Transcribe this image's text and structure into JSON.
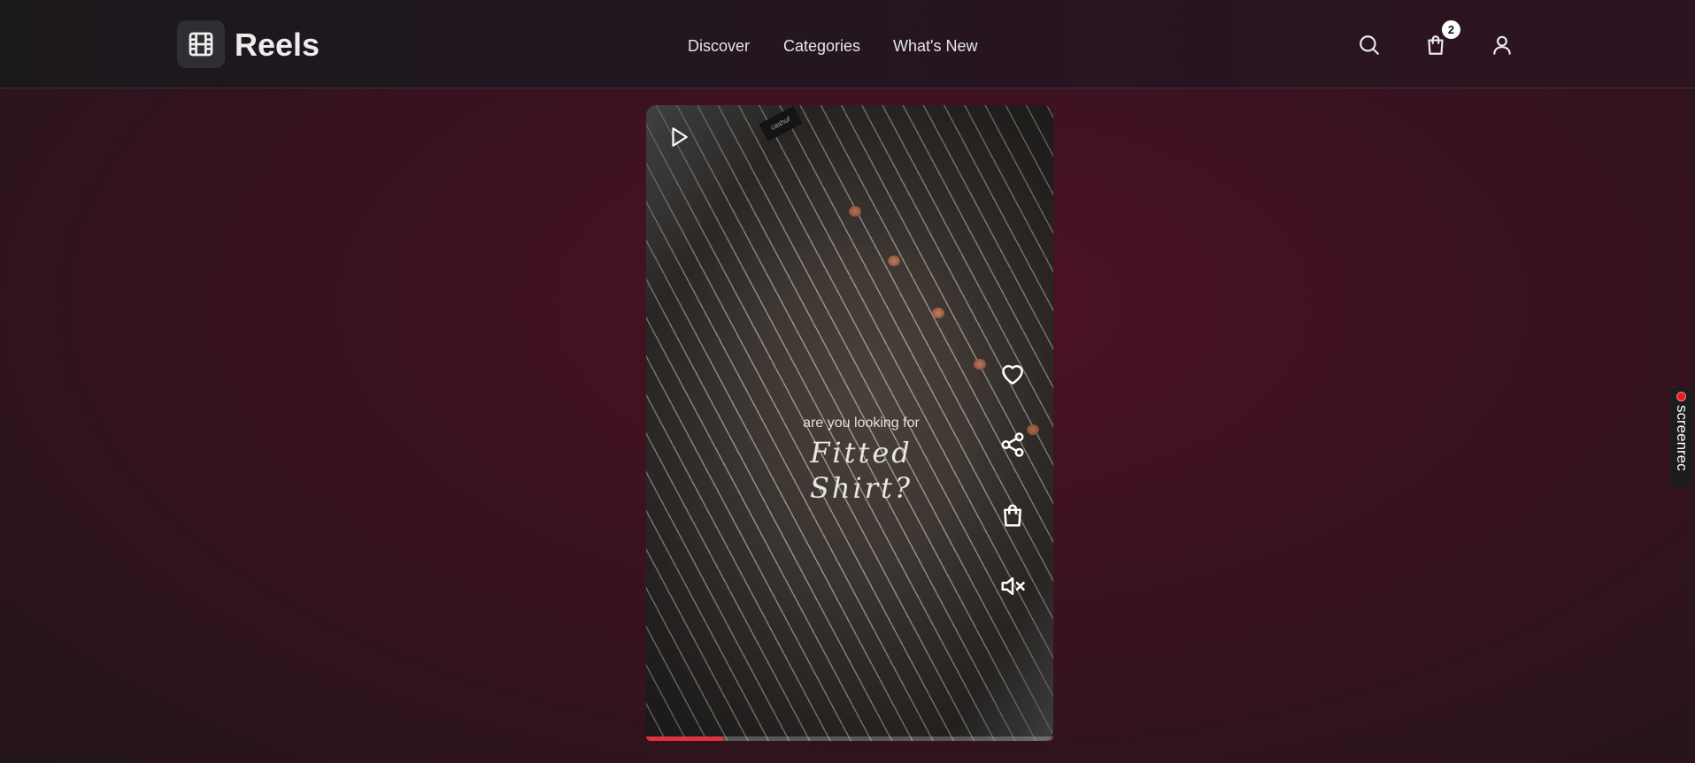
{
  "header": {
    "logo_text": "Reels",
    "nav": [
      {
        "label": "Discover"
      },
      {
        "label": "Categories"
      },
      {
        "label": "What's New"
      }
    ],
    "cart_count": "2",
    "icons": [
      "film-icon",
      "search-icon",
      "shopping-bag-icon",
      "user-icon"
    ]
  },
  "video": {
    "caption_sub": "are you looking for",
    "caption_main": "Fitted Shirt?",
    "label_tag": "cashuf",
    "progress": 0.19,
    "actions": [
      "heart-icon",
      "share-icon",
      "shopping-bag-icon",
      "mute-icon"
    ],
    "play_icon": "play-icon"
  },
  "overlay": {
    "recorder_text": "screenrec"
  },
  "colors": {
    "accent": "#e0333f",
    "background": "#3a1220"
  }
}
